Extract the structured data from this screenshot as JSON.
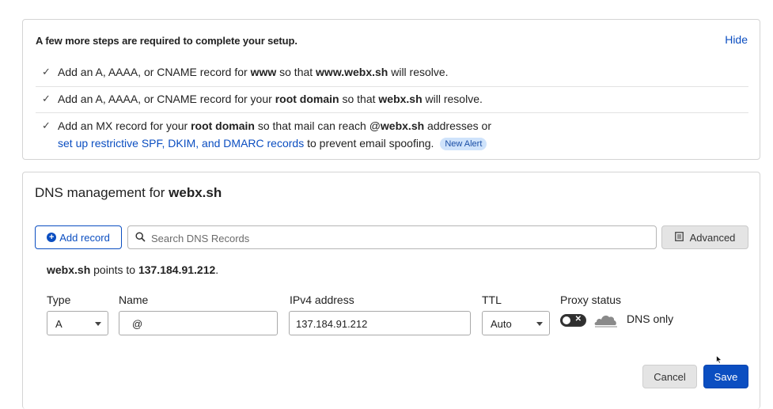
{
  "setup": {
    "title": "A few more steps are required to complete your setup.",
    "hide_label": "Hide",
    "steps": [
      {
        "pre": "Add an A, AAAA, or CNAME record for ",
        "bold1": "www",
        "mid": " so that ",
        "bold2": "www.webx.sh",
        "post": " will resolve."
      },
      {
        "pre": "Add an A, AAAA, or CNAME record for your ",
        "bold1": "root domain",
        "mid": " so that ",
        "bold2": "webx.sh",
        "post": " will resolve."
      },
      {
        "pre": "Add an MX record for your ",
        "bold1": "root domain",
        "mid": " so that mail can reach @",
        "bold2": "webx.sh",
        "post": " addresses or",
        "link": "set up restrictive SPF, DKIM, and DMARC records",
        "link_post": " to prevent email spoofing.",
        "badge": "New Alert"
      }
    ]
  },
  "dns": {
    "title_prefix": "DNS management for ",
    "title_domain": "webx.sh",
    "add_record_label": "Add record",
    "search_placeholder": "Search DNS Records",
    "advanced_label": "Advanced",
    "points_domain": "webx.sh",
    "points_text": " points to ",
    "points_ip": "137.184.91.212",
    "points_end": "."
  },
  "form": {
    "type_label": "Type",
    "name_label": "Name",
    "ipv4_label": "IPv4 address",
    "ttl_label": "TTL",
    "proxy_label": "Proxy status",
    "type_value": "A",
    "name_value": "@",
    "ipv4_value": "137.184.91.212",
    "ttl_value": "Auto",
    "proxy_value": "DNS only",
    "proxy_on": false,
    "cancel_label": "Cancel",
    "save_label": "Save"
  },
  "icons": {
    "check": "check-icon",
    "add": "plus-circle-icon",
    "search": "search-icon",
    "advanced": "document-icon",
    "cloud": "cloud-icon",
    "cursor": "mouse-pointer-icon"
  },
  "colors": {
    "accent": "#0b4ec1",
    "badge_bg": "#cfe3fb"
  }
}
